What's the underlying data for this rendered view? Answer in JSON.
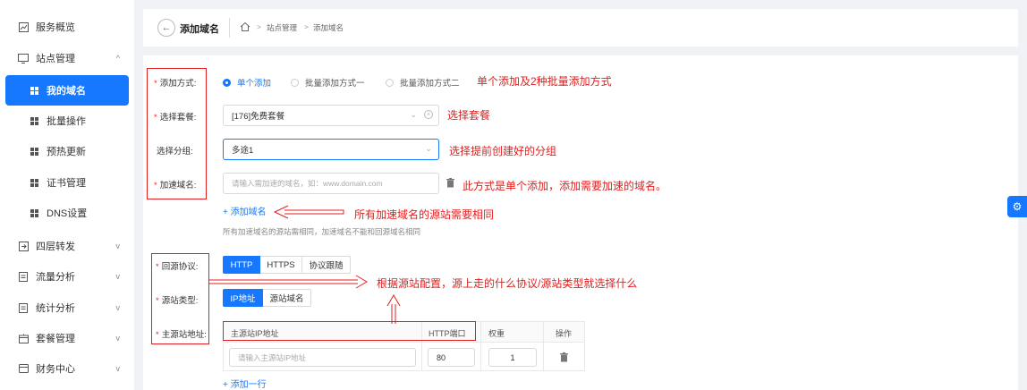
{
  "sidebar": {
    "items": [
      {
        "label": "服务概览",
        "icon": "chart-icon"
      },
      {
        "label": "站点管理",
        "icon": "site-icon"
      },
      {
        "label": "我的域名",
        "icon": "grid-icon"
      },
      {
        "label": "批量操作",
        "icon": "grid-icon"
      },
      {
        "label": "预热更新",
        "icon": "grid-icon"
      },
      {
        "label": "证书管理",
        "icon": "grid-icon"
      },
      {
        "label": "DNS设置",
        "icon": "grid-icon"
      },
      {
        "label": "四层转发",
        "icon": "forward-icon"
      },
      {
        "label": "流量分析",
        "icon": "doc-icon"
      },
      {
        "label": "统计分析",
        "icon": "doc-icon"
      },
      {
        "label": "套餐管理",
        "icon": "package-icon"
      },
      {
        "label": "财务中心",
        "icon": "wallet-icon"
      }
    ]
  },
  "header": {
    "title": "添加域名",
    "breadcrumb": [
      "站点管理",
      "添加域名"
    ]
  },
  "form": {
    "add_mode_label": "添加方式:",
    "add_modes": [
      "单个添加",
      "批量添加方式一",
      "批量添加方式二"
    ],
    "package_label": "选择套餐:",
    "package_value": "[176]免费套餐",
    "group_label": "选择分组:",
    "group_value": "多途1",
    "domain_label": "加速域名:",
    "domain_placeholder": "请输入需加速的域名，如：www.domain.com",
    "add_domain_link": "+ 添加域名",
    "domain_hint": "所有加速域名的源站需相同，加速域名不能和回源域名相同",
    "protocol_label": "回源协议:",
    "protocols": [
      "HTTP",
      "HTTPS",
      "协议跟随"
    ],
    "origin_type_label": "源站类型:",
    "origin_types": [
      "IP地址",
      "源站域名"
    ],
    "origin_addr_label": "主源站地址:",
    "table_headers": [
      "主源站IP地址",
      "HTTP端口",
      "权重",
      "操作"
    ],
    "ip_placeholder": "请输入主源站IP地址",
    "port_value": "80",
    "weight_value": "1",
    "add_row_link": "+ 添加一行"
  },
  "annotations": {
    "a1": "单个添加及2种批量添加方式",
    "a2": "选择套餐",
    "a3": "选择提前创建好的分组",
    "a4": "此方式是单个添加，添加需要加速的域名。",
    "a5": "所有加速域名的源站需要相同",
    "a6": "根据源站配置，源上走的什么协议/源站类型就选择什么"
  },
  "colors": {
    "accent": "#1677ff",
    "annotation": "#e02020"
  }
}
